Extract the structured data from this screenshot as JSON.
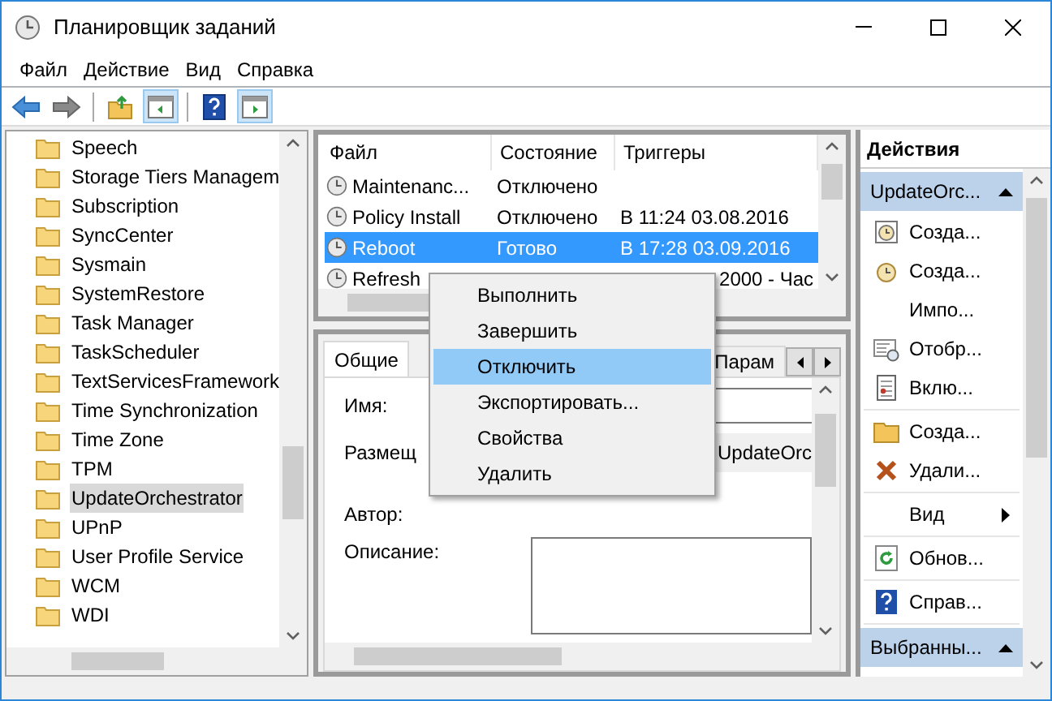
{
  "window": {
    "title": "Планировщик заданий"
  },
  "menu": [
    {
      "label": "Файл"
    },
    {
      "label": "Действие"
    },
    {
      "label": "Вид"
    },
    {
      "label": "Справка"
    }
  ],
  "toolbar": [
    {
      "kind": "back",
      "selected": false
    },
    {
      "kind": "forward",
      "selected": false
    },
    {
      "kind": "up-folder",
      "selected": false
    },
    {
      "kind": "tree-pane",
      "selected": true
    },
    {
      "kind": "help",
      "selected": false
    },
    {
      "kind": "action-pane",
      "selected": true
    }
  ],
  "tree": {
    "items": [
      {
        "label": "Speech",
        "selected": false
      },
      {
        "label": "Storage Tiers Managem",
        "selected": false
      },
      {
        "label": "Subscription",
        "selected": false
      },
      {
        "label": "SyncCenter",
        "selected": false
      },
      {
        "label": "Sysmain",
        "selected": false
      },
      {
        "label": "SystemRestore",
        "selected": false
      },
      {
        "label": "Task Manager",
        "selected": false
      },
      {
        "label": "TaskScheduler",
        "selected": false
      },
      {
        "label": "TextServicesFramework",
        "selected": false
      },
      {
        "label": "Time Synchronization",
        "selected": false
      },
      {
        "label": "Time Zone",
        "selected": false
      },
      {
        "label": "TPM",
        "selected": false
      },
      {
        "label": "UpdateOrchestrator",
        "selected": true
      },
      {
        "label": "UPnP",
        "selected": false
      },
      {
        "label": "User Profile Service",
        "selected": false
      },
      {
        "label": "WCM",
        "selected": false
      },
      {
        "label": "WDI",
        "selected": false
      }
    ]
  },
  "task_table": {
    "columns": [
      "Файл",
      "Состояние",
      "Триггеры"
    ],
    "rows": [
      {
        "name": "Maintenanc...",
        "status": "Отключено",
        "selected": false
      },
      {
        "name": "Policy Install",
        "status": "Отключено",
        "trigger": "В 11:24 03.08.2016",
        "selected": false
      },
      {
        "name": "Reboot",
        "status": "Готово",
        "trigger": "В 17:28 03.09.2016",
        "selected": true
      },
      {
        "name": "Refresh",
        "trigger": "2000 - Час",
        "selected": false
      }
    ]
  },
  "context_menu": {
    "items": [
      {
        "label": "Выполнить",
        "selected": false
      },
      {
        "label": "Завершить",
        "selected": false
      },
      {
        "label": "Отключить",
        "selected": true
      },
      {
        "label": "Экспортировать...",
        "selected": false
      },
      {
        "label": "Свойства",
        "selected": false
      },
      {
        "label": "Удалить",
        "selected": false
      }
    ]
  },
  "details": {
    "tabs": [
      {
        "label": "Общие",
        "selected": true
      },
      {
        "label": "Парам",
        "selected": false
      }
    ],
    "fields": [
      {
        "label": "Имя:",
        "kind": "input"
      },
      {
        "label": "Размещ",
        "kind": "text",
        "value": "UpdateOrc"
      },
      {
        "label": "Автор:",
        "kind": "text"
      },
      {
        "label": "Описание:",
        "kind": "textarea"
      }
    ]
  },
  "actions": {
    "title": "Действия",
    "groups": [
      {
        "title": "UpdateOrc...",
        "expanded": true,
        "sections": [
          {
            "items": [
              {
                "label": "Созда...",
                "kind": "new-task"
              },
              {
                "label": "Созда...",
                "kind": "basic-task"
              },
              {
                "label": "Импо...",
                "kind": "plain"
              },
              {
                "label": "Отобр...",
                "kind": "display"
              },
              {
                "label": "Вклю...",
                "kind": "log"
              }
            ]
          },
          {
            "items": [
              {
                "label": "Созда...",
                "kind": "folder"
              },
              {
                "label": "Удали...",
                "kind": "delete"
              }
            ]
          },
          {
            "items": [
              {
                "label": "Вид",
                "kind": "submenu"
              }
            ]
          },
          {
            "items": [
              {
                "label": "Обнов...",
                "kind": "refresh"
              }
            ]
          },
          {
            "items": [
              {
                "label": "Справ...",
                "kind": "help"
              }
            ]
          }
        ]
      },
      {
        "title": "Выбранны...",
        "expanded": true
      }
    ]
  }
}
